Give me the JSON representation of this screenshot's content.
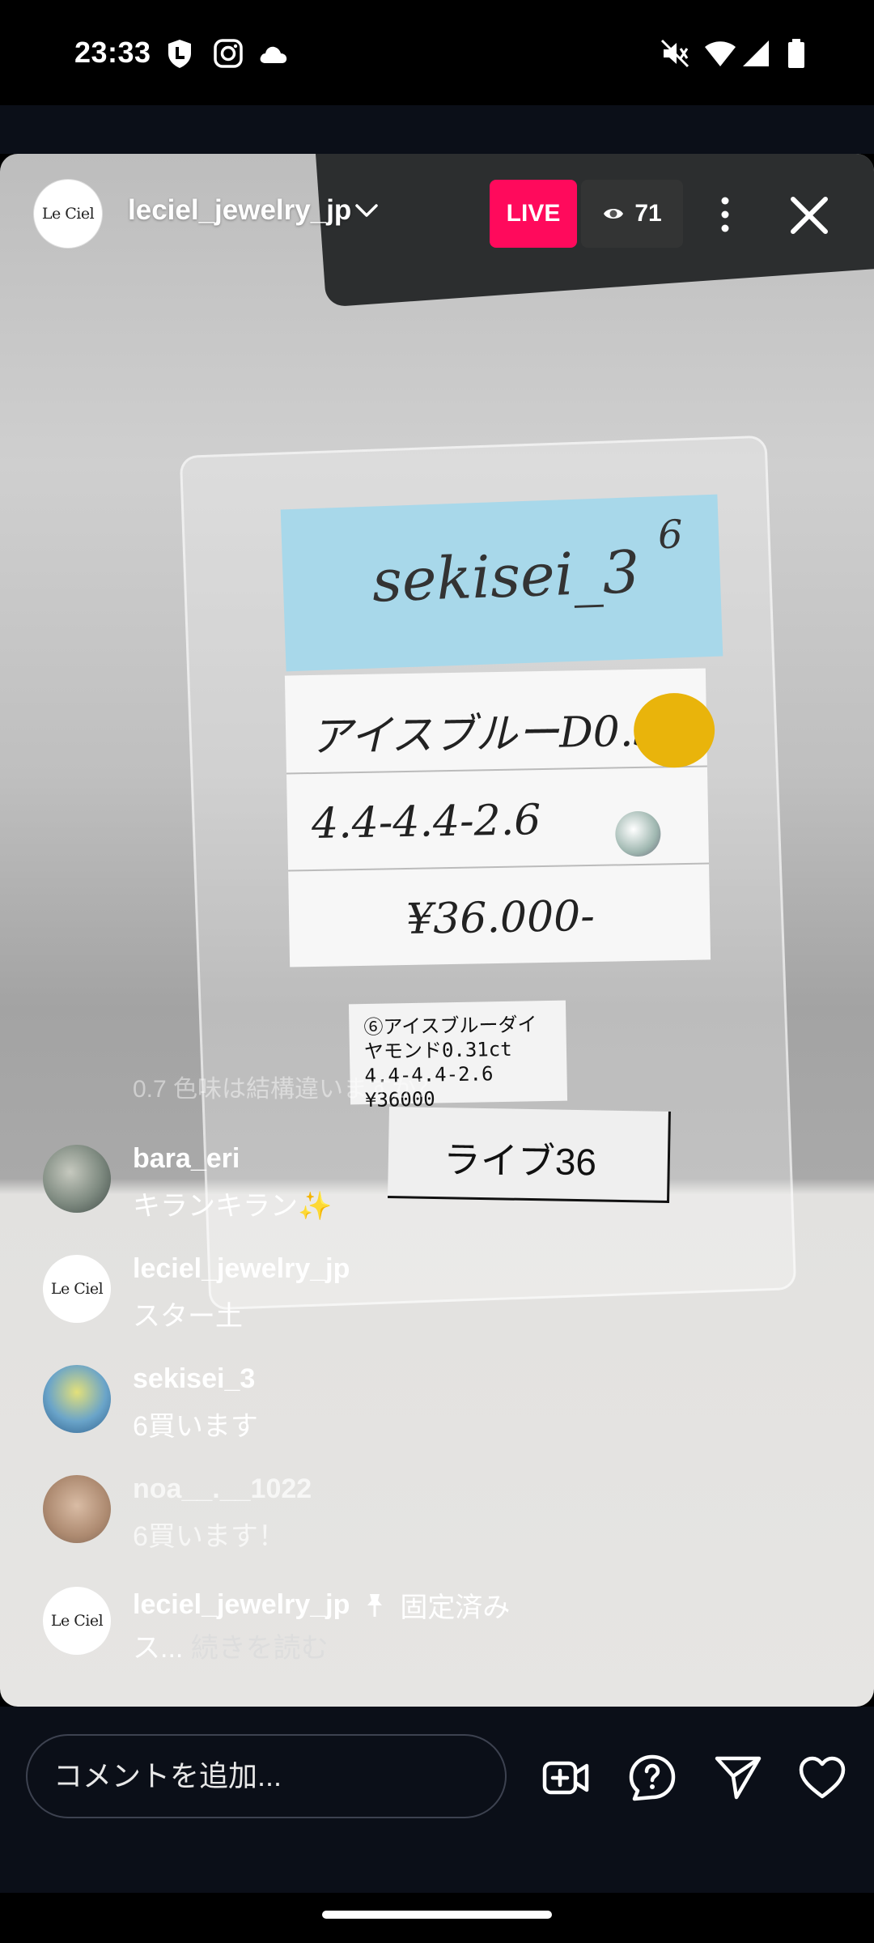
{
  "status_bar": {
    "time": "23:33",
    "left_icons": [
      "line-app-icon",
      "instagram-icon",
      "cloud-icon"
    ],
    "right_icons": [
      "mute-icon",
      "wifi-icon",
      "signal-icon",
      "battery-icon"
    ]
  },
  "live": {
    "host": {
      "username": "leciel_jewelry_jp",
      "avatar_text": "Le Ciel"
    },
    "badge": "LIVE",
    "viewer_count": "71",
    "video": {
      "sticky_note_text": "sekisei_3",
      "sticky_note_number": "6",
      "card_line1": "アイスブルーD0.31",
      "card_line2": "4.4-4.4-2.6",
      "card_line3": "¥36.000-",
      "tag_lines": [
        "⑥アイスブルーダイヤモンド0.31ct",
        "4.4-4.4-2.6",
        "¥36000"
      ],
      "tag_live": "ライブ36"
    },
    "ghost_comment": "0.7 色味は結構違いますか？",
    "comments": [
      {
        "user": "bara_eri",
        "text": "キランキラン✨",
        "avatar": "sheep-photo-avatar"
      },
      {
        "user": "leciel_jewelry_jp",
        "text": "スター土",
        "avatar": "leciel-logo-avatar"
      },
      {
        "user": "sekisei_3",
        "text": "6買います",
        "avatar": "budgie-photo-avatar"
      },
      {
        "user": "noa__.__1022",
        "text": "6買います！",
        "avatar": "dog-photo-avatar"
      }
    ],
    "pinned": {
      "user": "leciel_jewelry_jp",
      "pinned_label": "固定済み",
      "text_prefix": "ス...",
      "read_more": "続きを読む"
    }
  },
  "bottom_bar": {
    "comment_placeholder": "コメントを追加...",
    "buttons": [
      "add-video-icon",
      "question-icon",
      "send-icon",
      "heart-icon"
    ]
  },
  "colors": {
    "live_badge": "#ff0a5c",
    "background_dark": "#0b0f18",
    "sticky_note": "#a8d8ea",
    "yellow_dot": "#e9b40b"
  }
}
